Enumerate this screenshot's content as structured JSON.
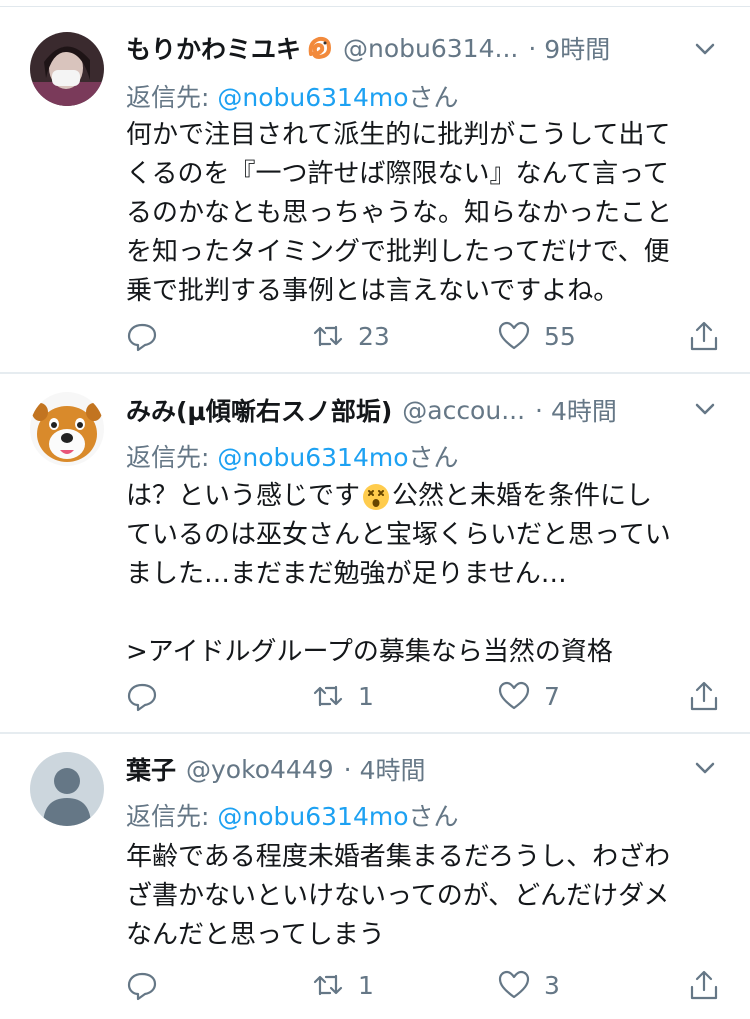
{
  "colors": {
    "link": "#1da1f2",
    "muted": "#657786",
    "text": "#14171a",
    "divider": "#e6ecf0"
  },
  "tweets": [
    {
      "name": "もりかわミユキ",
      "name_emoji": "shrimp-emoji",
      "handle": "@nobu6314...",
      "dot": "·",
      "time": "9時間",
      "reply_prefix": "返信先: ",
      "reply_to": "@nobu6314mo",
      "reply_suffix": "さん",
      "lines": [
        "何かで注目されて派生的に批判がこうして出て",
        "くるのを『一つ許せば際限ない』なんて言って",
        "るのかなとも思っちゃうな。知らなかったこと",
        "を知ったタイミングで批判したってだけで、便",
        "乗で批判する事例とは言えないですよね。"
      ],
      "retweets": "23",
      "likes": "55"
    },
    {
      "name": "みみ(μ傾噺右スノ部垢)",
      "handle": "@accou...",
      "dot": "·",
      "time": "4時間",
      "reply_prefix": "返信先: ",
      "reply_to": "@nobu6314mo",
      "reply_suffix": "さん",
      "lines": [
        "は？という感じです",
        "公然と未婚を条件にし",
        "ているのは巫女さんと宝塚くらいだと思ってい",
        "ました…まだまだ勉強が足りません…",
        "",
        ">アイドルグループの募集なら当然の資格"
      ],
      "body_emoji": "dizzy-face-emoji",
      "retweets": "1",
      "likes": "7"
    },
    {
      "name": "葉子",
      "handle": "@yoko4449",
      "dot": "·",
      "time": "4時間",
      "reply_prefix": "返信先: ",
      "reply_to": "@nobu6314mo",
      "reply_suffix": "さん",
      "lines": [
        "年齢である程度未婚者集まるだろうし、わざわ",
        "ざ書かないといけないってのが、どんだけダメ",
        "なんだと思ってしまう"
      ],
      "retweets": "1",
      "likes": "3"
    }
  ]
}
